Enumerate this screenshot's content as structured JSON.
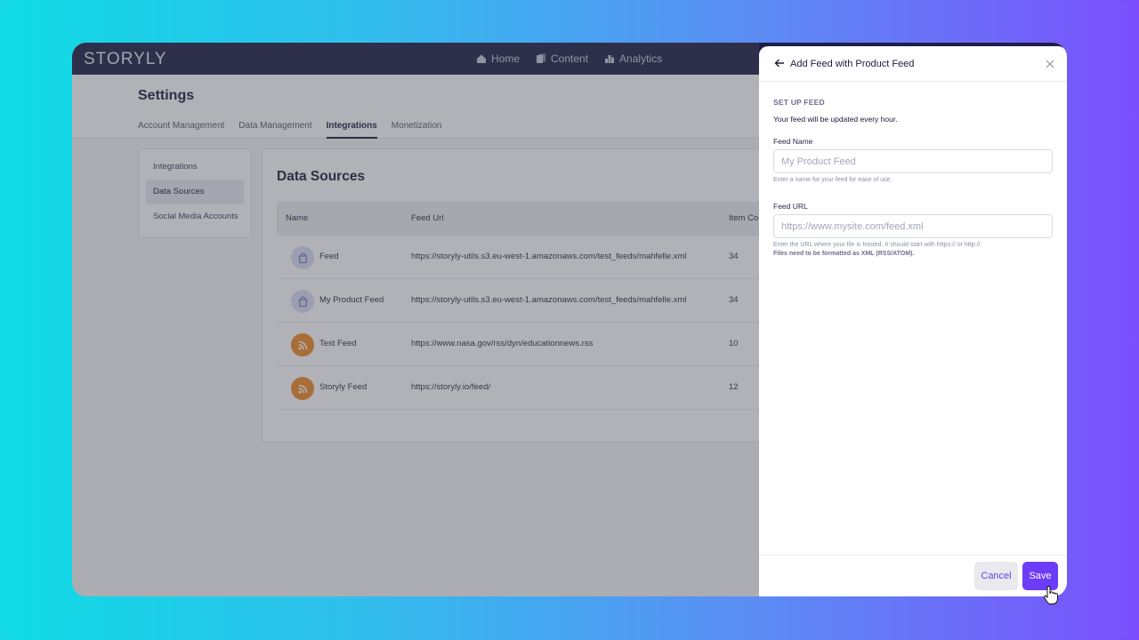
{
  "app": {
    "logo_text": "STORYLY",
    "nav": [
      {
        "label": "Home",
        "icon": "home-icon"
      },
      {
        "label": "Content",
        "icon": "content-icon"
      },
      {
        "label": "Analytics",
        "icon": "analytics-icon"
      }
    ]
  },
  "settings": {
    "title": "Settings",
    "tabs": [
      "Account Management",
      "Data Management",
      "Integrations",
      "Monetization"
    ],
    "active_tab": "Integrations"
  },
  "sidebar": {
    "items": [
      "Integrations",
      "Data Sources",
      "Social Media Accounts"
    ],
    "active_item": "Data Sources"
  },
  "data_sources": {
    "title": "Data Sources",
    "columns": [
      "Name",
      "Feed Url",
      "Item Co"
    ],
    "rows": [
      {
        "name": "Feed",
        "url": "https://storyly-utils.s3.eu-west-1.amazonaws.com/test_feeds/mahfelle.xml",
        "count": "34",
        "icon": "shopping-bag-icon"
      },
      {
        "name": "My Product Feed",
        "url": "https://storyly-utils.s3.eu-west-1.amazonaws.com/test_feeds/mahfelle.xml",
        "count": "34",
        "icon": "shopping-bag-icon"
      },
      {
        "name": "Test Feed",
        "url": "https://www.nasa.gov/rss/dyn/educationnews.rss",
        "count": "10",
        "icon": "rss-icon"
      },
      {
        "name": "Storyly Feed",
        "url": "https://storyly.io/feed/",
        "count": "12",
        "icon": "rss-icon"
      }
    ]
  },
  "drawer": {
    "title": "Add Feed with Product Feed",
    "section_title": "SET UP FEED",
    "section_subtitle": "Your feed will be updated every hour.",
    "feed_name": {
      "label": "Feed Name",
      "value": "",
      "placeholder": "My Product Feed",
      "help": "Enter a name for your feed for ease of use."
    },
    "feed_url": {
      "label": "Feed URL",
      "value": "",
      "placeholder": "https://www.mysite.com/feed.xml",
      "help": "Enter the URL where your file is hosted. It should start with https:// or http://.",
      "help_bold": "Files need to be formatted as XML (RSS/ATOM)."
    },
    "cancel_label": "Cancel",
    "save_label": "Save"
  },
  "colors": {
    "topbar": "#1e1f46",
    "accent": "#6d3cf7",
    "rss_orange": "#f08a24"
  }
}
